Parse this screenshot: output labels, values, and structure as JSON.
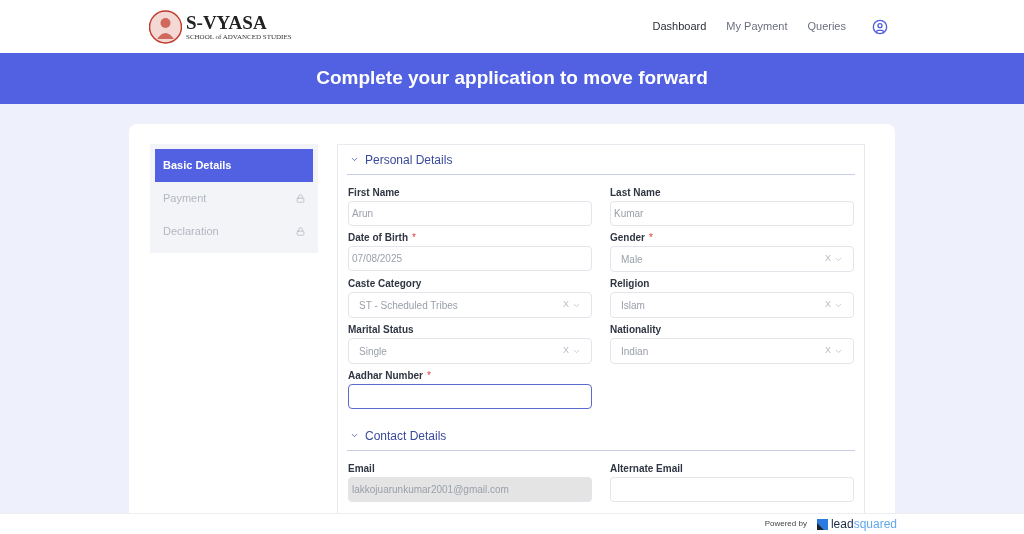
{
  "header": {
    "logo": {
      "title": "S-VYASA",
      "subtitle": "SCHOOL of ADVANCED STUDIES"
    },
    "nav": [
      {
        "label": "Dashboard",
        "selected": true
      },
      {
        "label": "My Payment",
        "selected": false
      },
      {
        "label": "Queries",
        "selected": false
      }
    ]
  },
  "banner": {
    "title": "Complete your application to move forward"
  },
  "sidebar": {
    "items": [
      {
        "label": "Basic Details",
        "selected": true,
        "locked": false
      },
      {
        "label": "Payment",
        "selected": false,
        "locked": true
      },
      {
        "label": "Declaration",
        "selected": false,
        "locked": true
      }
    ]
  },
  "sections": [
    {
      "title": "Personal Details",
      "expanded": true,
      "fields": [
        {
          "label": "First Name",
          "kind": "text",
          "value": "Arun",
          "focused": false,
          "disabled": false
        },
        {
          "label": "Last Name",
          "kind": "text",
          "value": "Kumar",
          "focused": false,
          "disabled": false
        },
        {
          "label": "Date of Birth",
          "kind": "text",
          "required_mark": "*",
          "value": "07/08/2025",
          "focused": false,
          "disabled": false
        },
        {
          "label": "Gender",
          "kind": "select",
          "required_mark": "*",
          "value": "Male",
          "clear": "X",
          "focused": false,
          "disabled": false
        },
        {
          "label": "Caste Category",
          "kind": "select",
          "value": "ST - Scheduled Tribes",
          "clear": "X",
          "focused": false,
          "disabled": false
        },
        {
          "label": "Religion",
          "kind": "select",
          "value": "Islam",
          "clear": "X",
          "focused": false,
          "disabled": false
        },
        {
          "label": "Marital Status",
          "kind": "select",
          "value": "Single",
          "clear": "X",
          "focused": false,
          "disabled": false
        },
        {
          "label": "Nationality",
          "kind": "select",
          "value": "Indian",
          "clear": "X",
          "focused": false,
          "disabled": false
        },
        {
          "label": "Aadhar Number",
          "kind": "text",
          "required_mark": "*",
          "focused": true,
          "disabled": false
        }
      ]
    },
    {
      "title": "Contact Details",
      "expanded": true,
      "fields": [
        {
          "label": "Email",
          "kind": "text",
          "value": "lakkojuarunkumar2001@gmail.com",
          "focused": false,
          "disabled": true
        },
        {
          "label": "Alternate Email",
          "kind": "text",
          "focused": false,
          "disabled": false
        }
      ]
    }
  ],
  "footer": {
    "powered_by": "Powered by",
    "brand_main": "lead",
    "brand_accent": "squared"
  }
}
